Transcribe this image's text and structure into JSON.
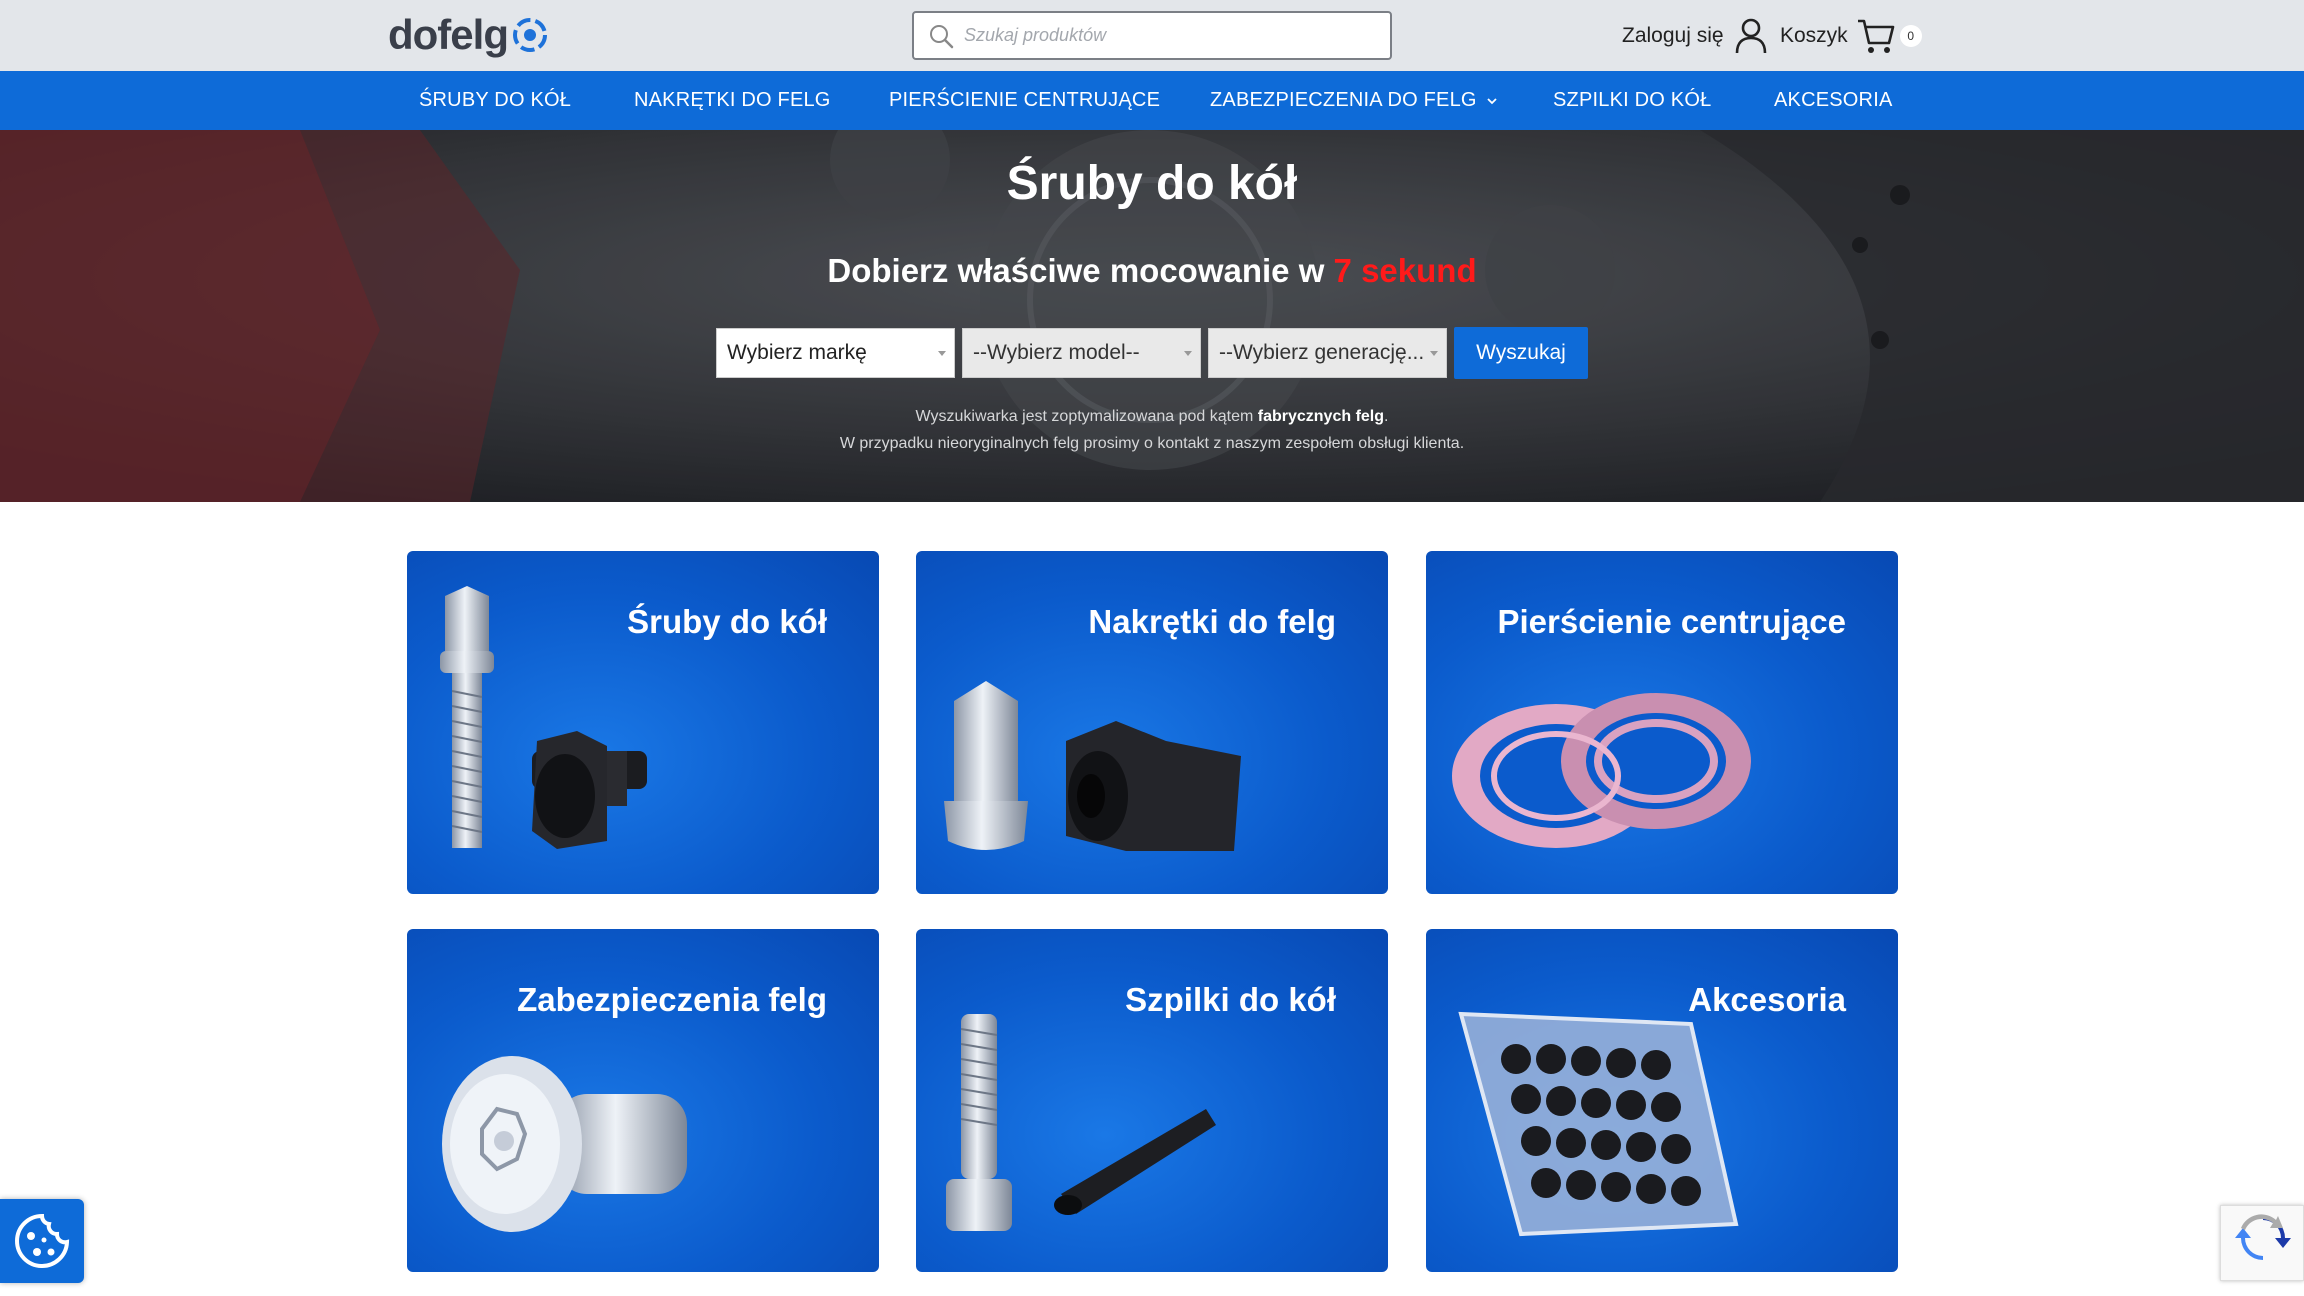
{
  "header": {
    "logo_text": "dofelg",
    "search_placeholder": "Szukaj produktów",
    "login_label": "Zaloguj się",
    "cart_label": "Koszyk",
    "cart_count": "0"
  },
  "nav": {
    "items": [
      {
        "label": "ŚRUBY DO KÓŁ"
      },
      {
        "label": "NAKRĘTKI DO FELG"
      },
      {
        "label": "PIERŚCIENIE CENTRUJĄCE"
      },
      {
        "label": "ZABEZPIECZENIA DO FELG"
      },
      {
        "label": "SZPILKI DO KÓŁ"
      },
      {
        "label": "AKCESORIA"
      }
    ]
  },
  "hero": {
    "title": "Śruby do kół",
    "subtitle_prefix": "Dobierz właściwe mocowanie w ",
    "subtitle_highlight": "7 sekund",
    "select_brand": "Wybierz markę",
    "select_model": "--Wybierz model--",
    "select_generation": "--Wybierz generację...",
    "search_button": "Wyszukaj",
    "note_line1_prefix": "Wyszukiwarka jest zoptymalizowana pod kątem ",
    "note_line1_bold": "fabrycznych felg",
    "note_line1_suffix": ".",
    "note_line2": "W przypadku nieoryginalnych felg prosimy o kontakt z naszym zespołem obsługi klienta."
  },
  "categories": [
    {
      "title": "Śruby do kół"
    },
    {
      "title": "Nakrętki do felg"
    },
    {
      "title": "Pierścienie centrujące"
    },
    {
      "title": "Zabezpieczenia felg"
    },
    {
      "title": "Szpilki do kół"
    },
    {
      "title": "Akcesoria"
    }
  ],
  "colors": {
    "brand_blue": "#0e6bd8",
    "highlight_red": "#ff1a1a",
    "header_bg": "#e3e6ea"
  },
  "icons": [
    "search-icon",
    "user-icon",
    "cart-icon",
    "chevron-down-icon",
    "cookie-icon",
    "recaptcha-icon"
  ]
}
